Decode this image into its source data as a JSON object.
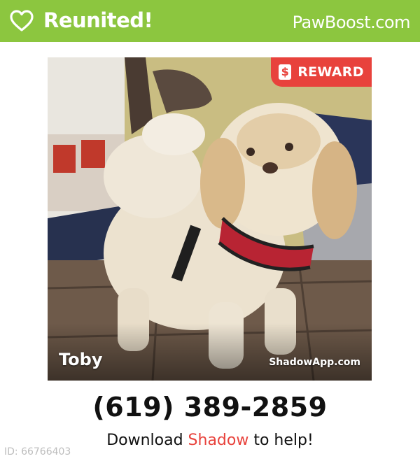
{
  "header": {
    "status": "Reunited!",
    "brand": "PawBoost.com"
  },
  "photo": {
    "reward_label": "REWARD",
    "reward_icon": "dollar-icon",
    "reward_icon_glyph": "$",
    "pet_name": "Toby",
    "app_url": "ShadowApp.com"
  },
  "contact": {
    "phone": "(619) 389-2859",
    "download_prefix": "Download ",
    "download_app": "Shadow",
    "download_suffix": " to help!"
  },
  "listing": {
    "id": "ID: 66766403"
  },
  "colors": {
    "header_bg": "#8cc63f",
    "reward_bg": "#e8423c",
    "accent": "#e8423c"
  }
}
